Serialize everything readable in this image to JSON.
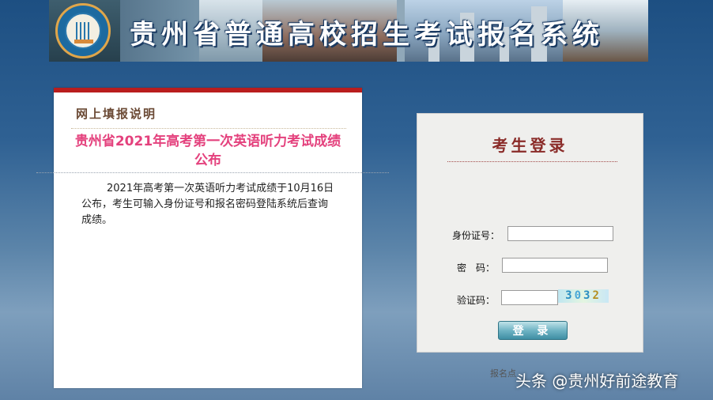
{
  "banner": {
    "title": "贵州省普通高校招生考试报名系统",
    "logo_icon": "province-exam-logo"
  },
  "notice": {
    "header": "网上填报说明",
    "title": "贵州省2021年高考第一次英语听力考试成绩公布",
    "body": "2021年高考第一次英语听力考试成绩于10月16日公布，考生可输入身份证号和报名密码登陆系统后查询成绩。"
  },
  "login": {
    "title": "考生登录",
    "id_label": "身份证号：",
    "id_value": "",
    "password_label": "密　码：",
    "password_value": "",
    "captcha_label": "验证码：",
    "captcha_value": "",
    "captcha_digits": [
      "3",
      "0",
      "3",
      "2"
    ],
    "submit_label": "登 录"
  },
  "footer": {
    "note": "报名点",
    "watermark": "头条 @贵州好前途教育"
  },
  "colors": {
    "accent_red": "#b91d1d",
    "notice_title": "#e4417d",
    "login_title": "#8a2b28"
  }
}
